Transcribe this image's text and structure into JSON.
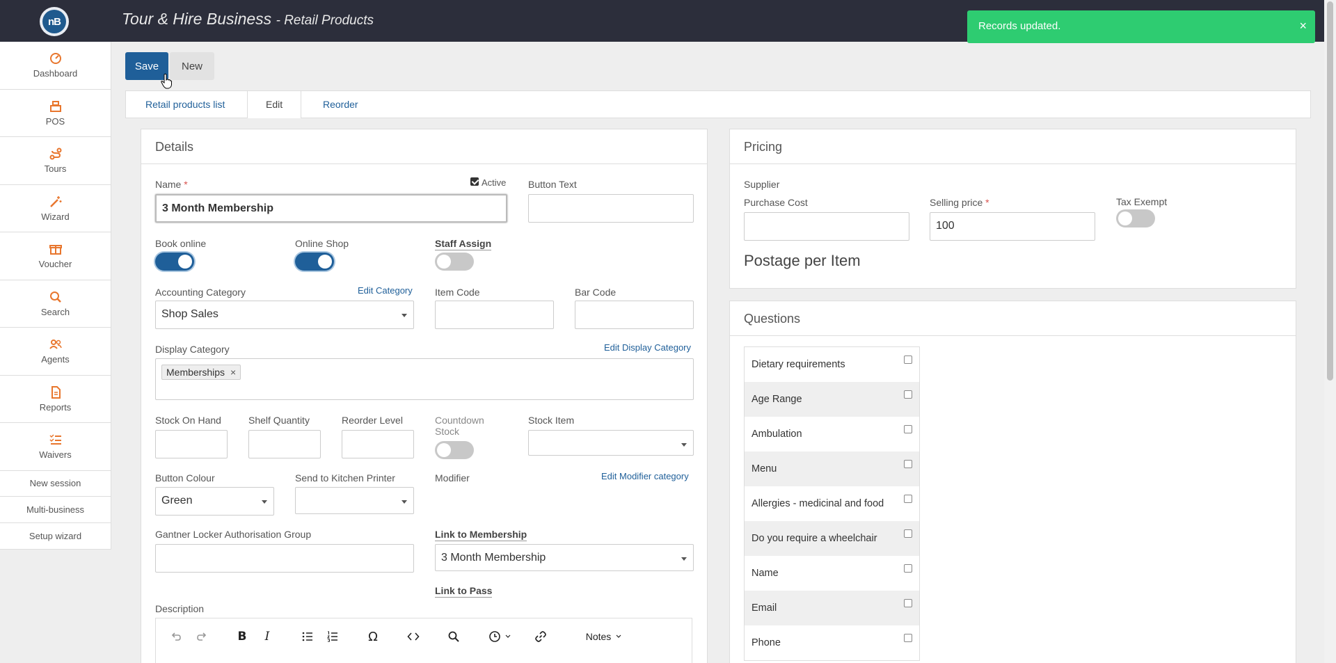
{
  "app": {
    "title": "Tour & Hire Business",
    "subtitle": "Retail Products",
    "logo": "nB"
  },
  "toast": {
    "message": "Records updated.",
    "close": "×"
  },
  "sidebar": {
    "items": [
      {
        "label": "Dashboard",
        "icon": "dashboard-icon"
      },
      {
        "label": "POS",
        "icon": "cash-register-icon"
      },
      {
        "label": "Tours",
        "icon": "route-icon"
      },
      {
        "label": "Wizard",
        "icon": "magic-wand-icon"
      },
      {
        "label": "Voucher",
        "icon": "gift-icon"
      },
      {
        "label": "Search",
        "icon": "search-icon"
      },
      {
        "label": "Agents",
        "icon": "users-icon"
      },
      {
        "label": "Reports",
        "icon": "report-icon"
      },
      {
        "label": "Waivers",
        "icon": "checklist-icon"
      }
    ],
    "links": [
      "New session",
      "Multi-business",
      "Setup wizard"
    ]
  },
  "toolbar": {
    "save": "Save",
    "new": "New"
  },
  "tabs": [
    "Retail products list",
    "Edit",
    "Reorder"
  ],
  "details": {
    "heading": "Details",
    "name_label": "Name",
    "required_mark": "*",
    "name_value": "3 Month Membership",
    "active_label": "Active",
    "active_checked": true,
    "button_text_label": "Button Text",
    "button_text_value": "",
    "book_online_label": "Book online",
    "book_online_on": true,
    "online_shop_label": "Online Shop",
    "online_shop_on": true,
    "staff_assign_label": "Staff Assign",
    "staff_assign_on": false,
    "accounting_category_label": "Accounting Category",
    "edit_category_link": "Edit Category",
    "accounting_category_value": "Shop Sales",
    "item_code_label": "Item Code",
    "bar_code_label": "Bar Code",
    "display_category_label": "Display Category",
    "edit_display_category_link": "Edit Display Category",
    "display_category_tag": "Memberships",
    "tag_remove": "×",
    "stock_on_hand_label": "Stock On Hand",
    "shelf_quantity_label": "Shelf Quantity",
    "reorder_level_label": "Reorder Level",
    "countdown_stock_label_1": "Countdown",
    "countdown_stock_label_2": "Stock",
    "countdown_stock_on": false,
    "stock_item_label": "Stock Item",
    "stock_item_value": "",
    "button_colour_label": "Button Colour",
    "button_colour_value": "Green",
    "kitchen_printer_label": "Send to Kitchen Printer",
    "kitchen_printer_value": "",
    "modifier_label": "Modifier",
    "edit_modifier_link": "Edit Modifier category",
    "gantner_label": "Gantner Locker Authorisation Group",
    "gantner_value": "",
    "link_membership_label": "Link to Membership",
    "link_membership_value": "3 Month Membership",
    "link_pass_label": "Link to Pass",
    "description_label": "Description",
    "editor_notes_menu": "Notes"
  },
  "pricing": {
    "heading": "Pricing",
    "supplier_label": "Supplier",
    "purchase_cost_label": "Purchase Cost",
    "purchase_cost_value": "",
    "selling_price_label": "Selling price",
    "selling_price_value": "100",
    "tax_exempt_label": "Tax Exempt",
    "tax_exempt_on": false,
    "postage_label": "Postage per Item"
  },
  "questions": {
    "heading": "Questions",
    "items": [
      "Dietary requirements",
      "Age Range",
      "Ambulation",
      "Menu",
      "Allergies - medicinal and food",
      "Do you require a wheelchair",
      "Name",
      "Email",
      "Phone"
    ]
  },
  "colors": {
    "primary": "#1f5f99",
    "topbar": "#2c2e3b",
    "toast": "#2ecc71",
    "accent_icon": "#e8762d"
  }
}
